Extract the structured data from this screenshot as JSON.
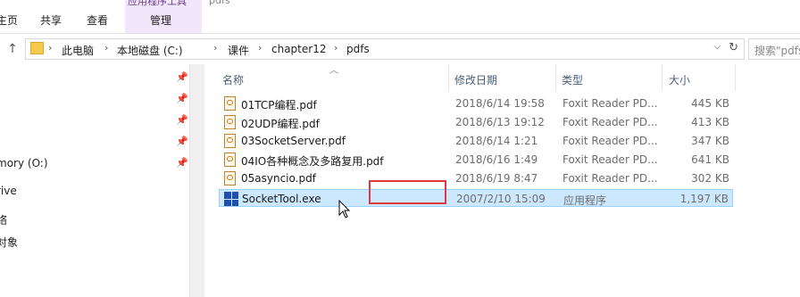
{
  "ribbon": {
    "tabs": [
      "主页",
      "共享",
      "查看"
    ],
    "context_group_label": "应用程序工具",
    "context_tab": "管理",
    "title_fragment": "pdfs"
  },
  "address": {
    "breadcrumbs": [
      "此电脑",
      "本地磁盘 (C:)",
      "课件",
      "chapter12",
      "pdfs"
    ],
    "search_placeholder": "搜索\"pdfs\""
  },
  "nav": {
    "items": [
      "mory (O:)",
      "rive",
      "络",
      "对象"
    ]
  },
  "columns": {
    "name": "名称",
    "date": "修改日期",
    "type": "类型",
    "size": "大小"
  },
  "files": [
    {
      "name": "01TCP编程.pdf",
      "date": "2018/6/14 19:58",
      "type": "Foxit Reader PD...",
      "size": "445 KB",
      "icon": "pdf-icon"
    },
    {
      "name": "02UDP编程.pdf",
      "date": "2018/6/13 19:12",
      "type": "Foxit Reader PD...",
      "size": "413 KB",
      "icon": "pdf-icon"
    },
    {
      "name": "03SocketServer.pdf",
      "date": "2018/6/14 1:21",
      "type": "Foxit Reader PD...",
      "size": "347 KB",
      "icon": "pdf-icon"
    },
    {
      "name": "04IO各种概念及多路复用.pdf",
      "date": "2018/6/16 1:49",
      "type": "Foxit Reader PD...",
      "size": "641 KB",
      "icon": "pdf-icon"
    },
    {
      "name": "05asyncio.pdf",
      "date": "2018/6/19 8:47",
      "type": "Foxit Reader PD...",
      "size": "302 KB",
      "icon": "pdf-icon"
    },
    {
      "name": "SocketTool.exe",
      "date": "2007/2/10 15:09",
      "type": "应用程序",
      "size": "1,197 KB",
      "icon": "exe-icon",
      "selected": true
    }
  ],
  "colors": {
    "selection": "#cce8ff",
    "highlight_box": "#e0393b",
    "context_tab_bg": "#f2e6fb"
  }
}
